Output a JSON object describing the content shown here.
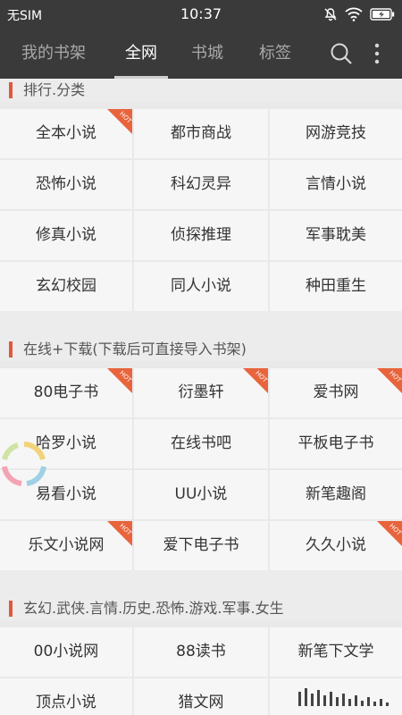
{
  "status": {
    "carrier": "无SIM",
    "time": "10:37"
  },
  "nav": {
    "tabs": [
      {
        "label": "我的书架",
        "active": false
      },
      {
        "label": "全网",
        "active": true
      },
      {
        "label": "书城",
        "active": false
      },
      {
        "label": "标签",
        "active": false
      }
    ],
    "icons": [
      "search-icon",
      "more-vertical-icon"
    ]
  },
  "sections": [
    {
      "title": "排行.分类",
      "items": [
        {
          "label": "全本小说",
          "hot": true
        },
        {
          "label": "都市商战",
          "hot": false
        },
        {
          "label": "网游竞技",
          "hot": false
        },
        {
          "label": "恐怖小说",
          "hot": false
        },
        {
          "label": "科幻灵异",
          "hot": false
        },
        {
          "label": "言情小说",
          "hot": false
        },
        {
          "label": "修真小说",
          "hot": false
        },
        {
          "label": "侦探推理",
          "hot": false
        },
        {
          "label": "军事耽美",
          "hot": false
        },
        {
          "label": "玄幻校园",
          "hot": false
        },
        {
          "label": "同人小说",
          "hot": false
        },
        {
          "label": "种田重生",
          "hot": false
        }
      ]
    },
    {
      "title": "在线+下载(下载后可直接导入书架)",
      "items": [
        {
          "label": "80电子书",
          "hot": true
        },
        {
          "label": "衍墨轩",
          "hot": true
        },
        {
          "label": "爱书网",
          "hot": true
        },
        {
          "label": "哈罗小说",
          "hot": false
        },
        {
          "label": "在线书吧",
          "hot": false
        },
        {
          "label": "平板电子书",
          "hot": false
        },
        {
          "label": "易看小说",
          "hot": false
        },
        {
          "label": "UU小说",
          "hot": false
        },
        {
          "label": "新笔趣阁",
          "hot": false
        },
        {
          "label": "乐文小说网",
          "hot": true
        },
        {
          "label": "爱下电子书",
          "hot": false
        },
        {
          "label": "久久小说",
          "hot": true
        }
      ]
    },
    {
      "title": "玄幻.武侠.言情.历史.恐怖.游戏.军事.女生",
      "items": [
        {
          "label": "00小说网",
          "hot": false
        },
        {
          "label": "88读书",
          "hot": false
        },
        {
          "label": "新笔下文学",
          "hot": false
        },
        {
          "label": "顶点小说",
          "hot": false
        },
        {
          "label": "猎文网",
          "hot": false
        },
        {
          "label": "",
          "hot": false
        }
      ]
    }
  ],
  "hot_badge": {
    "label": "HOT",
    "color": "#e8643c"
  },
  "colors": {
    "accent": "#e0593b",
    "header_bg": "#3a3a3a",
    "cell_bg": "#f6f6f6",
    "page_bg": "#e9e9e9"
  }
}
